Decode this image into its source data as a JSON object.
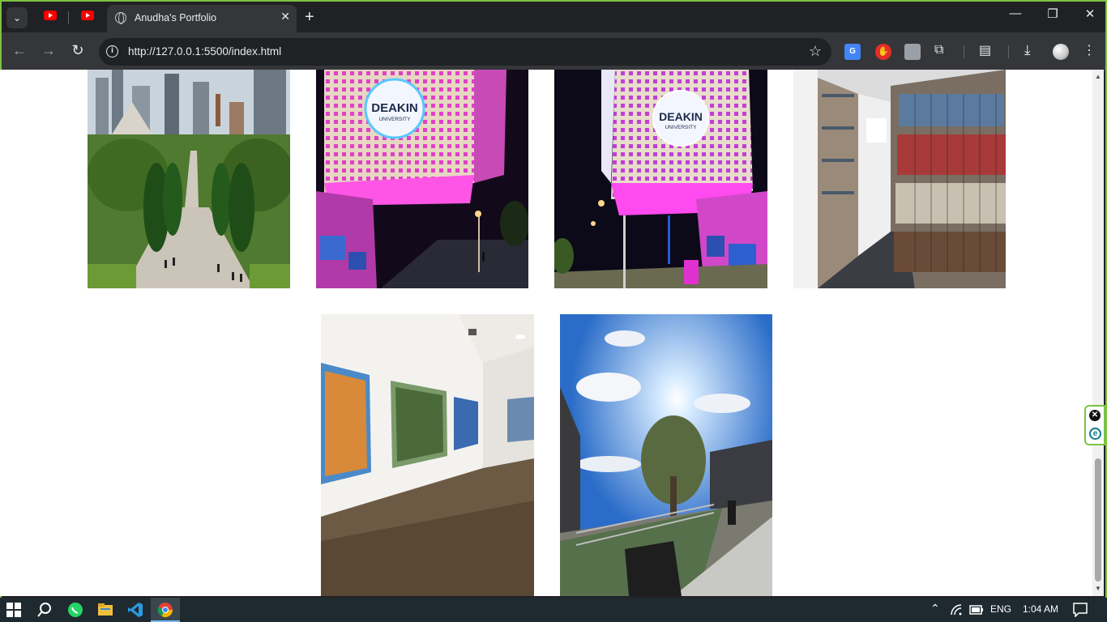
{
  "browser": {
    "tab_title": "Anudha's Portfolio",
    "url": "http://127.0.0.1:5500/index.html",
    "accent_color": "#7dc242"
  },
  "gallery": {
    "row1": [
      {
        "name": "city-avenue-photo"
      },
      {
        "name": "deakin-cube-photo-1",
        "sign_line1": "DEAKIN",
        "sign_line2": "UNIVERSITY"
      },
      {
        "name": "deakin-cube-photo-2",
        "sign_line1": "DEAKIN",
        "sign_line2": "UNIVERSITY"
      },
      {
        "name": "library-shelves-photo"
      }
    ],
    "row2": [
      {
        "name": "art-gallery-photo"
      },
      {
        "name": "campus-sky-photo"
      }
    ]
  },
  "taskbar": {
    "language": "ENG",
    "time": "1:04 AM"
  }
}
